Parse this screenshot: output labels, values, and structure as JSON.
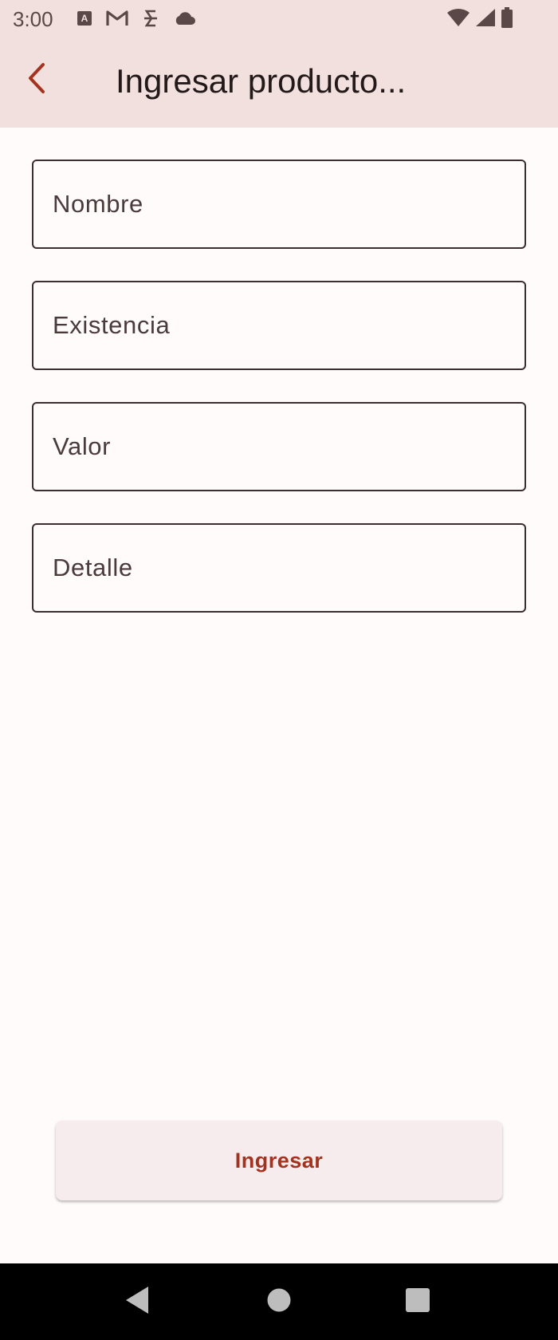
{
  "status_bar": {
    "time": "3:00",
    "left_icons": [
      "autofill-icon",
      "gmail-icon",
      "sim-icon",
      "cloud-icon"
    ],
    "right_icons": [
      "wifi-icon",
      "signal-icon",
      "battery-icon"
    ]
  },
  "app_bar": {
    "back_icon": "chevron-left-icon",
    "title": "Ingresar producto..."
  },
  "form": {
    "fields": [
      {
        "placeholder": "Nombre",
        "value": ""
      },
      {
        "placeholder": "Existencia",
        "value": ""
      },
      {
        "placeholder": "Valor",
        "value": ""
      },
      {
        "placeholder": "Detalle",
        "value": ""
      }
    ]
  },
  "actions": {
    "submit_label": "Ingresar"
  },
  "nav_bar": {
    "icons": [
      "back-triangle-icon",
      "home-circle-icon",
      "recents-square-icon"
    ]
  },
  "colors": {
    "app_bar_bg": "#f2e0df",
    "accent": "#a3331f",
    "background": "#fffbfb"
  }
}
